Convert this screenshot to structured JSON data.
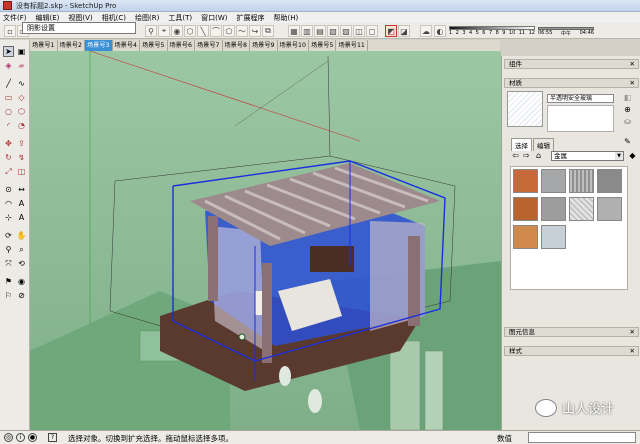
{
  "window": {
    "title": "没有标题2.skp - SketchUp Pro"
  },
  "menu": [
    "文件(F)",
    "编辑(E)",
    "视图(V)",
    "相机(C)",
    "绘图(R)",
    "工具(T)",
    "窗口(W)",
    "扩展程序",
    "帮助(H)"
  ],
  "tooltip": "阴影设置",
  "shadow_scale": {
    "labels": [
      "1",
      "2",
      "3",
      "4",
      "5",
      "6",
      "7",
      "8",
      "9",
      "10",
      "11",
      "12"
    ]
  },
  "time_scale": {
    "left": "06:55",
    "mid": "中午",
    "right": "04:46"
  },
  "scene_tabs": [
    "场景号1",
    "场景号2",
    "场景号3",
    "场景号4",
    "场景号5",
    "场景号6",
    "场景号7",
    "场景号8",
    "场景号9",
    "场景号10",
    "场景号5",
    "场景号11"
  ],
  "active_scene_index": 2,
  "panel": {
    "components_title": "组件",
    "materials_title": "材质",
    "material_name": "半透明安全玻璃",
    "tabs": [
      "选择",
      "编辑"
    ],
    "category": "金属",
    "preview_title": "图元信息",
    "styles_title": "样式",
    "close_glyph": "✕",
    "tab_close_glyph": "✕"
  },
  "status": {
    "text": "选择对象。切换到扩充选择。拖动鼠标选择多项。",
    "measure_label": "数值",
    "measure_value": ""
  },
  "watermark": {
    "text": "山人设计"
  },
  "colors": {
    "scene_active": "#3b8fd4",
    "viewport_green": "#8ebc96",
    "selection_blue": "#1a2ee0",
    "pergola_wood": "#8b7060",
    "floor_dark": "#5a3a2e"
  },
  "icons": [
    "select-icon",
    "eraser-icon",
    "paint-icon",
    "line-icon",
    "rectangle-icon",
    "circle-icon",
    "arc-icon",
    "move-icon",
    "rotate-icon",
    "scale-icon",
    "offset-icon",
    "push-pull-icon",
    "tape-icon",
    "text-icon",
    "orbit-icon",
    "pan-icon",
    "zoom-icon",
    "walk-icon",
    "look-around-icon",
    "section-icon"
  ]
}
